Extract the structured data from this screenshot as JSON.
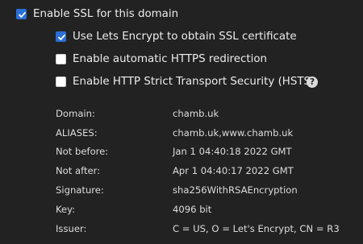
{
  "ssl": {
    "enable_label": "Enable SSL for this domain",
    "enable_checked": true
  },
  "options": [
    {
      "label": "Use Lets Encrypt to obtain SSL certificate",
      "checked": true
    },
    {
      "label": "Enable automatic HTTPS redirection",
      "checked": false
    },
    {
      "label": "Enable HTTP Strict Transport Security (HSTS)",
      "checked": false,
      "help_icon": "question-circle-icon"
    }
  ],
  "help_glyph": "?",
  "certificate": [
    {
      "key": "Domain:",
      "value": "chamb.uk"
    },
    {
      "key": "ALIASES:",
      "value": "chamb.uk,www.chamb.uk"
    },
    {
      "key": "Not before:",
      "value": "Jan 1 04:40:18 2022 GMT"
    },
    {
      "key": "Not after:",
      "value": "Apr 1 04:40:17 2022 GMT"
    },
    {
      "key": "Signature:",
      "value": "sha256WithRSAEncryption"
    },
    {
      "key": "Key:",
      "value": "4096 bit"
    },
    {
      "key": "Issuer:",
      "value": "C = US, O = Let's Encrypt, CN = R3"
    }
  ],
  "colors": {
    "background": "#222222",
    "checkbox_checked": "#2a6fd6",
    "text": "#e6e6e6"
  }
}
